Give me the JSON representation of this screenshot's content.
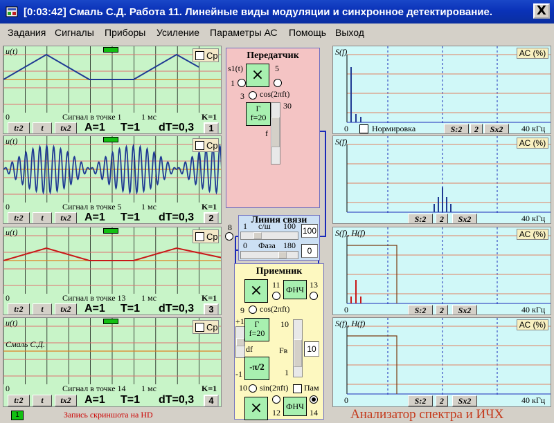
{
  "window": {
    "title": "[0:03:42] Смаль С.Д.  Работа 11. Линейные виды модуляции и синхронное детектирование.",
    "close_glyph": "X"
  },
  "menu": [
    "Задания",
    "Сигналы",
    "Приборы",
    "Усиление",
    "Параметры АС",
    "Помощь",
    "Выход"
  ],
  "osc": [
    {
      "ylabel": "u(t)",
      "cb": "Ср",
      "time_left": "0",
      "caption": "Сигнал в точке 1",
      "time_unit": "1 мс",
      "k": "K=1",
      "A": "A=1",
      "T": "T=1",
      "dT": "dT=0,3",
      "num": "1",
      "color": "#1f3a93",
      "label_extra": ""
    },
    {
      "ylabel": "u(t)",
      "cb": "Ср",
      "time_left": "0",
      "caption": "Сигнал в точке 5",
      "time_unit": "1 мс",
      "k": "K=1",
      "A": "A=1",
      "T": "T=1",
      "dT": "dT=0,3",
      "num": "2",
      "color": "#1f3a93",
      "label_extra": ""
    },
    {
      "ylabel": "u(t)",
      "cb": "Ср",
      "time_left": "0",
      "caption": "Сигнал в точке 13",
      "time_unit": "1 мс",
      "k": "K=1",
      "A": "A=1",
      "T": "T=1",
      "dT": "dT=0,3",
      "num": "3",
      "color": "#c81818",
      "label_extra": ""
    },
    {
      "ylabel": "u(t)",
      "cb": "Ср",
      "time_left": "0",
      "caption": "Сигнал в точке 14",
      "time_unit": "1 мс",
      "k": "K=1",
      "A": "A=1",
      "T": "T=1",
      "dT": "dT=0,3",
      "num": "4",
      "color": "#1f3a93",
      "label_extra": "Смаль С.Д."
    }
  ],
  "osc_buttons": [
    "t:2",
    "t",
    "tx2"
  ],
  "transmitter": {
    "title": "Передатчик",
    "s1": "s1(t)",
    "n1": "1",
    "n3": "3",
    "n5": "5",
    "cos": "cos(2πft)",
    "gen_line1": "Г",
    "gen_line2": "f=20",
    "slider_max": "30",
    "f_label": "f"
  },
  "channel": {
    "title": "Линия связи",
    "snr_min": "1",
    "snr_label": "с/ш",
    "snr_max": "100",
    "snr_value": "100",
    "phase_min": "0",
    "phase_label": "Фаза",
    "phase_max": "180",
    "phase_value": "0",
    "node": "8"
  },
  "receiver": {
    "title": "Приемник",
    "n9": "9",
    "n11": "11",
    "n13": "13",
    "n10": "10",
    "n12": "12",
    "n14": "14",
    "cos": "cos(2πft)",
    "sin": "sin(2πft)",
    "gen_line1": "Г",
    "gen_line2": "f=20",
    "fnch": "ФНЧ",
    "df": "df",
    "fv": "Fв",
    "fv_top": "10",
    "fv_value": "10",
    "fv_bottom": "1",
    "plus1": "+1",
    "minus1": "-1",
    "phase_btn": "-π/2",
    "pam": "Пам"
  },
  "spectra": [
    {
      "label": "S(f)",
      "ac": "АС (%)",
      "zero": "0",
      "norm": "Нормировка",
      "unit": "40 кГц",
      "color": "#1f3a93"
    },
    {
      "label": "S(f)",
      "ac": "АС (%)",
      "zero": "0",
      "norm": "",
      "unit": "40 кГц",
      "color": "#1f3a93"
    },
    {
      "label": "S(f), H(f)",
      "ac": "АС (%)",
      "zero": "0",
      "norm": "",
      "unit": "40 кГц",
      "color": "#c81818"
    },
    {
      "label": "S(f), H(f)",
      "ac": "АС (%)",
      "zero": "0",
      "norm": "",
      "unit": "40 кГц",
      "color": "#1f3a93"
    }
  ],
  "spec_buttons": [
    "S:2",
    "2",
    "Sx2"
  ],
  "status": {
    "indicator": "1",
    "text": "Запись скриншота на HD"
  },
  "footer_title": "Анализатор спектра и ИЧХ",
  "colors": {
    "osc_bg": "#c8f4c8",
    "spec_bg": "#d0f8f8",
    "tx_bg": "#f4c4c4",
    "rx_bg": "#fdf8c0",
    "link_bg": "#cce0f4"
  }
}
